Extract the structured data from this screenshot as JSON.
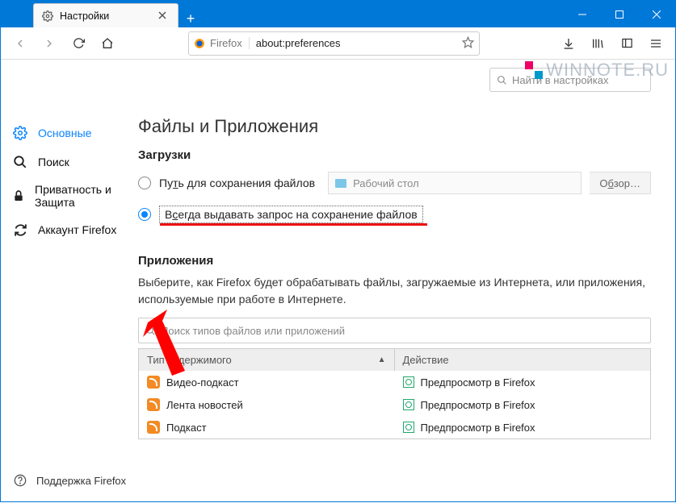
{
  "window": {
    "tab_title": "Настройки",
    "min": "",
    "max": "",
    "close": ""
  },
  "nav": {
    "identity_label": "Firefox",
    "url": "about:preferences"
  },
  "watermark": "WINNOTE.RU",
  "search_prefs_placeholder": "Найти в настройках",
  "sidebar": {
    "general": "Основные",
    "search": "Поиск",
    "privacy": "Приватность и Защита",
    "account": "Аккаунт Firefox",
    "support": "Поддержка Firefox"
  },
  "main": {
    "section_title": "Файлы и Приложения",
    "downloads_heading": "Загрузки",
    "radio_save_path": "Путь для сохранения файлов",
    "save_path_value": "Рабочий стол",
    "browse_label": "Обзор…",
    "radio_always_ask": "Всегда выдавать запрос на сохранение файлов",
    "apps_heading": "Приложения",
    "apps_desc": "Выберите, как Firefox будет обрабатывать файлы, загружаемые из Интернета, или приложения, используемые при работе в Интернете.",
    "apps_search_placeholder": "Поиск типов файлов или приложений",
    "col_type": "Тип содержимого",
    "col_action": "Действие",
    "rows": [
      {
        "type": "Видео-подкаст",
        "action": "Предпросмотр в Firefox"
      },
      {
        "type": "Лента новостей",
        "action": "Предпросмотр в Firefox"
      },
      {
        "type": "Подкаст",
        "action": "Предпросмотр в Firefox"
      }
    ]
  }
}
